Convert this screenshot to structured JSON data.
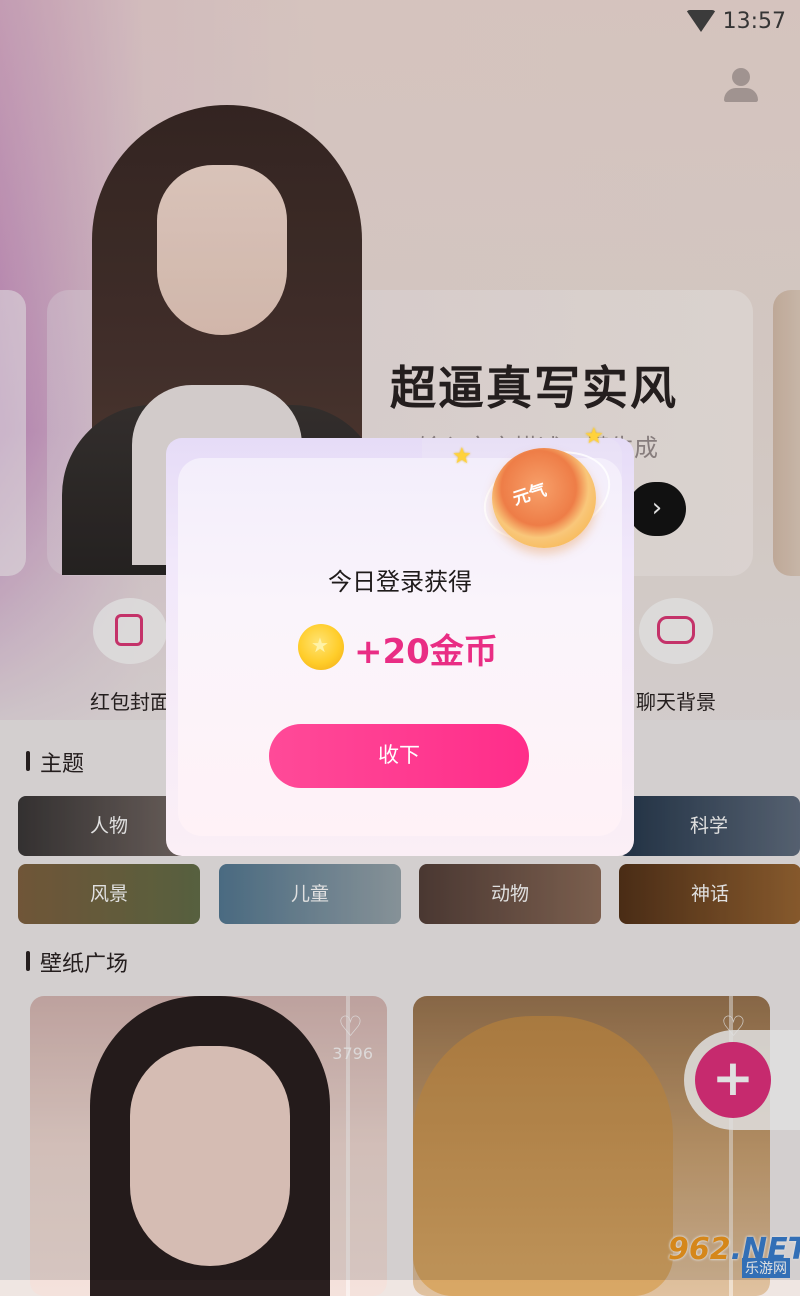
{
  "status_bar": {
    "time": "13:57"
  },
  "banner": {
    "title": "超逼真写实风",
    "subtitle": "输入文字描述一键生成",
    "go_symbol": "›"
  },
  "features": [
    {
      "label": "红包封面",
      "icon": "red-packet-icon"
    },
    {
      "label": "聊天背景",
      "icon": "chat-bubble-icon"
    }
  ],
  "sections": {
    "theme": "主题",
    "wallpaper": "壁纸广场"
  },
  "categories": [
    "人物",
    "科学",
    "风景",
    "儿童",
    "动物",
    "神话"
  ],
  "wallpapers": [
    {
      "like_count": "3796",
      "icon": "heart-icon"
    },
    {
      "like_count": "",
      "icon": "heart-icon"
    }
  ],
  "fab": {
    "symbol": "+"
  },
  "watermark": {
    "brand": "962.NET",
    "brand_num": "962",
    "brand_suffix": ".NET",
    "sub": "乐游网"
  },
  "modal": {
    "badge_text": "元气",
    "title": "今日登录获得",
    "reward": "+20金币",
    "accept_label": "收下"
  },
  "colors": {
    "accent": "#e92d84",
    "button": "#ff3a90"
  }
}
